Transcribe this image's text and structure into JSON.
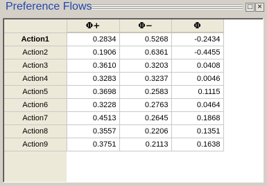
{
  "window": {
    "title": "Preference Flows",
    "restore_icon": "restore-icon",
    "restore_glyph": "□",
    "close_icon": "close-icon",
    "close_glyph": "×"
  },
  "table": {
    "columns": [
      "Φ+",
      "Φ−",
      "Φ"
    ],
    "rows": [
      {
        "label": "Action1",
        "values": [
          "0.2834",
          "0.5268",
          "-0.2434"
        ]
      },
      {
        "label": "Action2",
        "values": [
          "0.1906",
          "0.6361",
          "-0.4455"
        ]
      },
      {
        "label": "Action3",
        "values": [
          "0.3610",
          "0.3203",
          "0.0408"
        ]
      },
      {
        "label": "Action4",
        "values": [
          "0.3283",
          "0.3237",
          "0.0046"
        ]
      },
      {
        "label": "Action5",
        "values": [
          "0.3698",
          "0.2583",
          "0.1115"
        ]
      },
      {
        "label": "Action6",
        "values": [
          "0.3228",
          "0.2763",
          "0.0464"
        ]
      },
      {
        "label": "Action7",
        "values": [
          "0.4513",
          "0.2645",
          "0.1868"
        ]
      },
      {
        "label": "Action8",
        "values": [
          "0.3557",
          "0.2206",
          "0.1351"
        ]
      },
      {
        "label": "Action9",
        "values": [
          "0.3751",
          "0.2113",
          "0.1638"
        ]
      }
    ],
    "selected_row": "Action1"
  }
}
